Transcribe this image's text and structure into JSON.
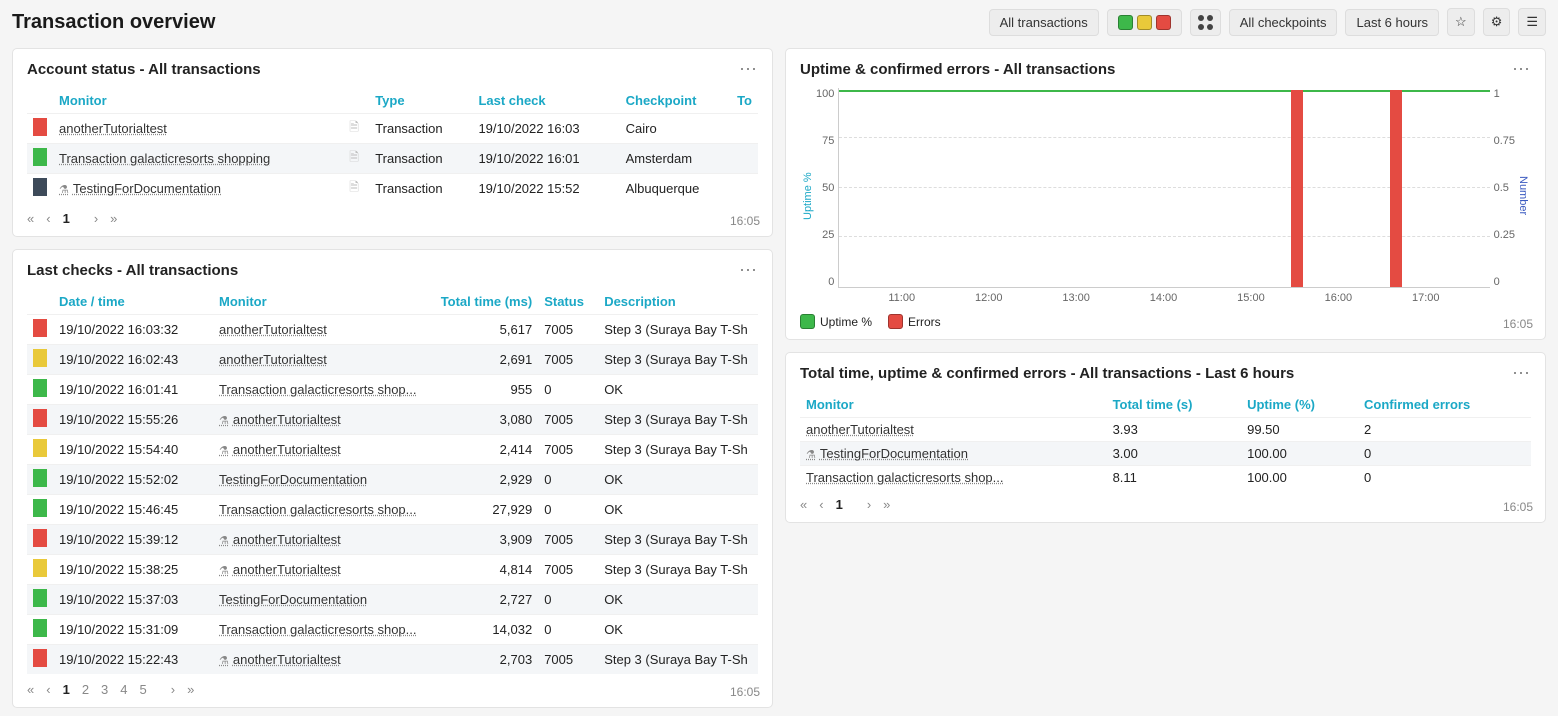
{
  "page_title": "Transaction overview",
  "toolbar": {
    "all_transactions": "All transactions",
    "all_checkpoints": "All checkpoints",
    "last_6_hours": "Last 6 hours"
  },
  "timestamp": "16:05",
  "panel_account_status": {
    "title": "Account status - All transactions",
    "columns": {
      "monitor": "Monitor",
      "type": "Type",
      "last_check": "Last check",
      "checkpoint": "Checkpoint",
      "total": "To"
    },
    "rows": [
      {
        "status": "r",
        "monitor": "anotherTutorialtest",
        "type": "Transaction",
        "last_check": "19/10/2022 16:03",
        "checkpoint": "Cairo",
        "flask": false
      },
      {
        "status": "g",
        "monitor": "Transaction galacticresorts shopping",
        "type": "Transaction",
        "last_check": "19/10/2022 16:01",
        "checkpoint": "Amsterdam",
        "flask": false
      },
      {
        "status": "d",
        "monitor": "TestingForDocumentation",
        "type": "Transaction",
        "last_check": "19/10/2022 15:52",
        "checkpoint": "Albuquerque",
        "flask": true
      }
    ],
    "pages": [
      "1"
    ]
  },
  "panel_last_checks": {
    "title": "Last checks - All transactions",
    "columns": {
      "datetime": "Date / time",
      "monitor": "Monitor",
      "total_time": "Total time (ms)",
      "status": "Status",
      "description": "Description"
    },
    "rows": [
      {
        "bar": "r",
        "datetime": "19/10/2022 16:03:32",
        "monitor": "anotherTutorialtest",
        "flask": false,
        "total_time": "5,617",
        "status": "7005",
        "description": "Step 3 (Suraya Bay T-Sh"
      },
      {
        "bar": "y",
        "datetime": "19/10/2022 16:02:43",
        "monitor": "anotherTutorialtest",
        "flask": false,
        "total_time": "2,691",
        "status": "7005",
        "description": "Step 3 (Suraya Bay T-Sh"
      },
      {
        "bar": "g",
        "datetime": "19/10/2022 16:01:41",
        "monitor": "Transaction galacticresorts shop...",
        "flask": false,
        "total_time": "955",
        "status": "0",
        "description": "OK"
      },
      {
        "bar": "r",
        "datetime": "19/10/2022 15:55:26",
        "monitor": "anotherTutorialtest",
        "flask": true,
        "total_time": "3,080",
        "status": "7005",
        "description": "Step 3 (Suraya Bay T-Sh"
      },
      {
        "bar": "y",
        "datetime": "19/10/2022 15:54:40",
        "monitor": "anotherTutorialtest",
        "flask": true,
        "total_time": "2,414",
        "status": "7005",
        "description": "Step 3 (Suraya Bay T-Sh"
      },
      {
        "bar": "g",
        "datetime": "19/10/2022 15:52:02",
        "monitor": "TestingForDocumentation",
        "flask": false,
        "total_time": "2,929",
        "status": "0",
        "description": "OK"
      },
      {
        "bar": "g",
        "datetime": "19/10/2022 15:46:45",
        "monitor": "Transaction galacticresorts shop...",
        "flask": false,
        "total_time": "27,929",
        "status": "0",
        "description": "OK"
      },
      {
        "bar": "r",
        "datetime": "19/10/2022 15:39:12",
        "monitor": "anotherTutorialtest",
        "flask": true,
        "total_time": "3,909",
        "status": "7005",
        "description": "Step 3 (Suraya Bay T-Sh"
      },
      {
        "bar": "y",
        "datetime": "19/10/2022 15:38:25",
        "monitor": "anotherTutorialtest",
        "flask": true,
        "total_time": "4,814",
        "status": "7005",
        "description": "Step 3 (Suraya Bay T-Sh"
      },
      {
        "bar": "g",
        "datetime": "19/10/2022 15:37:03",
        "monitor": "TestingForDocumentation",
        "flask": false,
        "total_time": "2,727",
        "status": "0",
        "description": "OK"
      },
      {
        "bar": "g",
        "datetime": "19/10/2022 15:31:09",
        "monitor": "Transaction galacticresorts shop...",
        "flask": false,
        "total_time": "14,032",
        "status": "0",
        "description": "OK"
      },
      {
        "bar": "r",
        "datetime": "19/10/2022 15:22:43",
        "monitor": "anotherTutorialtest",
        "flask": true,
        "total_time": "2,703",
        "status": "7005",
        "description": "Step 3 (Suraya Bay T-Sh"
      }
    ],
    "pages": [
      "1",
      "2",
      "3",
      "4",
      "5"
    ]
  },
  "panel_uptime": {
    "title": "Uptime & confirmed errors - All transactions",
    "legend": {
      "uptime": "Uptime %",
      "errors": "Errors"
    },
    "ylabel_left": "Uptime %",
    "ylabel_right": "Number"
  },
  "panel_totals": {
    "title": "Total time, uptime & confirmed errors - All transactions - Last 6 hours",
    "columns": {
      "monitor": "Monitor",
      "total_time": "Total time (s)",
      "uptime": "Uptime (%)",
      "errors": "Confirmed errors"
    },
    "rows": [
      {
        "monitor": "anotherTutorialtest",
        "flask": false,
        "total_time": "3.93",
        "uptime": "99.50",
        "errors": "2"
      },
      {
        "monitor": "TestingForDocumentation",
        "flask": true,
        "total_time": "3.00",
        "uptime": "100.00",
        "errors": "0"
      },
      {
        "monitor": "Transaction galacticresorts shop...",
        "flask": false,
        "total_time": "8.11",
        "uptime": "100.00",
        "errors": "0"
      }
    ],
    "pages": [
      "1"
    ]
  },
  "chart_data": {
    "type": "line+bar",
    "x_ticks": [
      "11:00",
      "12:00",
      "13:00",
      "14:00",
      "15:00",
      "16:00",
      "17:00"
    ],
    "left_axis": {
      "label": "Uptime %",
      "ticks": [
        100,
        75,
        50,
        25,
        0
      ],
      "range": [
        0,
        100
      ]
    },
    "right_axis": {
      "label": "Number",
      "ticks": [
        1,
        0.75,
        0.5,
        0.25,
        0
      ],
      "range": [
        0,
        1
      ]
    },
    "series": [
      {
        "name": "Uptime %",
        "type": "line",
        "color": "#3db84a",
        "data": [
          {
            "x": "11:00",
            "y": 100
          },
          {
            "x": "12:00",
            "y": 100
          },
          {
            "x": "13:00",
            "y": 100
          },
          {
            "x": "14:00",
            "y": 100
          },
          {
            "x": "15:00",
            "y": 100
          },
          {
            "x": "15:10",
            "y": 98
          },
          {
            "x": "15:20",
            "y": 100
          },
          {
            "x": "16:00",
            "y": 100
          },
          {
            "x": "16:05",
            "y": 98
          }
        ]
      },
      {
        "name": "Errors",
        "type": "bar",
        "color": "#e44b42",
        "data": [
          {
            "x": "15:10",
            "y": 1
          },
          {
            "x": "16:05",
            "y": 1
          }
        ]
      }
    ]
  }
}
